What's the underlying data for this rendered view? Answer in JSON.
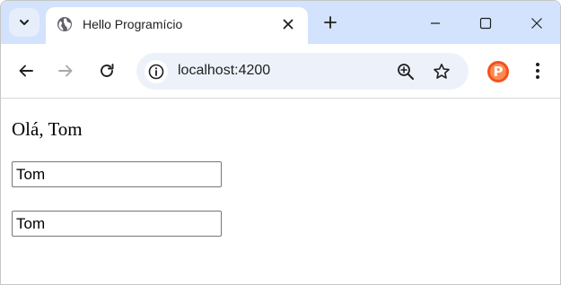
{
  "browser": {
    "tab": {
      "title": "Hello Programício"
    },
    "omnibox": {
      "url": "localhost:4200"
    },
    "profile": {
      "initial": "P"
    },
    "colors": {
      "tabstrip": "#d3e3fd",
      "omnibox": "#edf2fa",
      "profile_badge": "#f4511e"
    }
  },
  "page": {
    "greeting": "Olá, Tom",
    "inputs": [
      {
        "value": "Tom"
      },
      {
        "value": "Tom"
      }
    ]
  }
}
